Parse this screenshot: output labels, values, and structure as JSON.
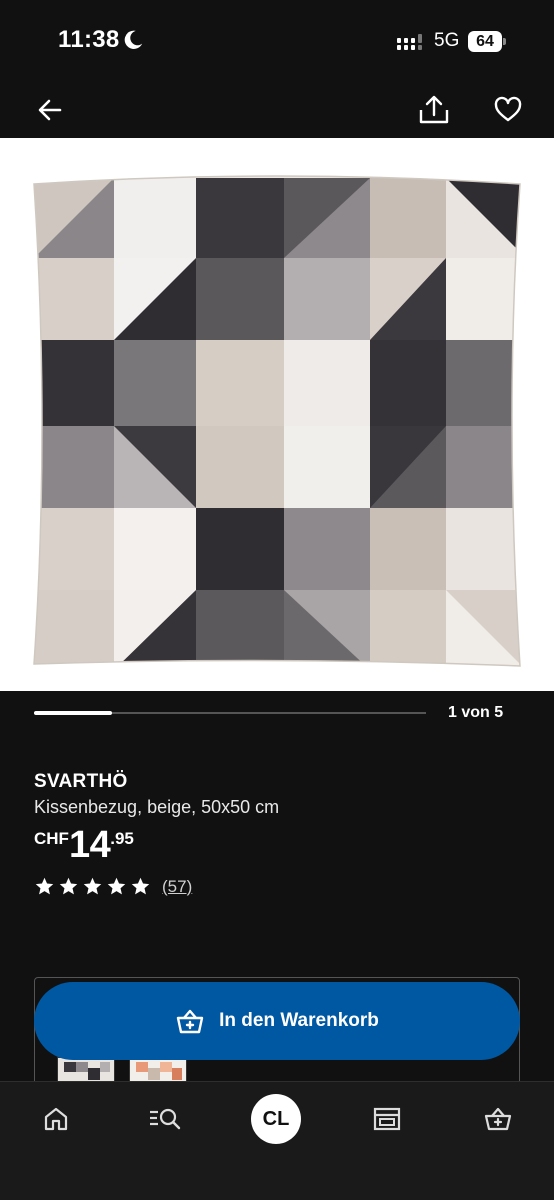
{
  "status_bar": {
    "time": "11:38",
    "network": "5G",
    "battery": "64"
  },
  "nav": {
    "back_icon": "arrow-left-icon",
    "share_icon": "share-icon",
    "favorite_icon": "heart-icon"
  },
  "gallery": {
    "page_indicator": "1 von 5",
    "progress": 0.2
  },
  "product": {
    "name": "SVARTHÖ",
    "description": "Kissenbezug, beige, 50x50 cm",
    "currency": "CHF",
    "price_integer": "14",
    "price_decimal": ".95",
    "rating": 5,
    "review_count": "(57)"
  },
  "cart": {
    "label": "In den Warenkorb",
    "icon": "cart-icon"
  },
  "bottom_nav": {
    "items": [
      "home-icon",
      "search-icon",
      "profile",
      "store-icon",
      "cart-icon"
    ],
    "avatar_initials": "CL"
  },
  "colors": {
    "background": "#111111",
    "accent": "#0058a3",
    "text": "#ffffff"
  }
}
